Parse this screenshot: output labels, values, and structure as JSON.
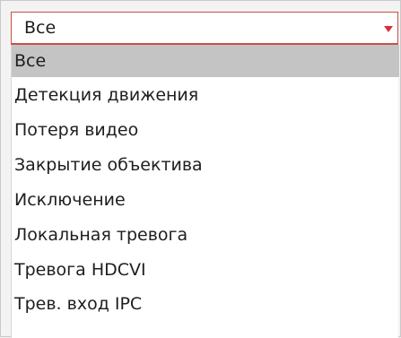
{
  "select": {
    "value": "Все"
  },
  "options": [
    "Все",
    "Детекция движения",
    "Потеря видео",
    "Закрытие объектива",
    "Исключение",
    "Локальная тревога",
    "Тревога HDCVI",
    "Трев. вход IPC"
  ],
  "selected_index": 0,
  "colors": {
    "accent": "#d6313a",
    "selected_bg": "#c4c4c4"
  },
  "icons": {
    "caret": "triangle-down-icon"
  }
}
